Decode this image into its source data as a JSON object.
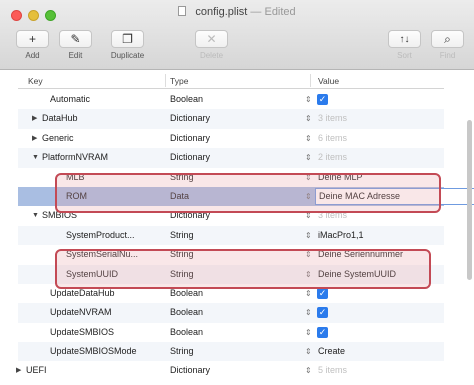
{
  "window": {
    "title": "config.plist",
    "status": "— Edited"
  },
  "toolbar": {
    "add_icon": "+",
    "add_label": "Add",
    "edit_icon": "✎",
    "edit_label": "Edit",
    "duplicate_icon": "❐",
    "duplicate_label": "Duplicate",
    "delete_icon": "✕",
    "delete_label": "Delete",
    "sort_icon": "↑↓",
    "sort_label": "Sort",
    "find_icon": "⌕",
    "find_label": "Find"
  },
  "columns": {
    "key": "Key",
    "type": "Type",
    "value": "Value"
  },
  "rows": [
    {
      "key": "Automatic",
      "type": "Boolean",
      "value": "",
      "checkbox": true
    },
    {
      "key": "DataHub",
      "type": "Dictionary",
      "value": "3 items",
      "disclosure": "▶"
    },
    {
      "key": "Generic",
      "type": "Dictionary",
      "value": "6 items",
      "disclosure": "▶"
    },
    {
      "key": "PlatformNVRAM",
      "type": "Dictionary",
      "value": "2 items",
      "disclosure": "▼"
    },
    {
      "key": "MLB",
      "type": "String",
      "value": "Deine MLP"
    },
    {
      "key": "ROM",
      "type": "Data",
      "value": "Deine MAC Adresse"
    },
    {
      "key": "SMBIOS",
      "type": "Dictionary",
      "value": "3 items",
      "disclosure": "▼"
    },
    {
      "key": "SystemProduct...",
      "type": "String",
      "value": "iMacPro1,1"
    },
    {
      "key": "SystemSerialNu...",
      "type": "String",
      "value": "Deine Seriennummer"
    },
    {
      "key": "SystemUUID",
      "type": "String",
      "value": "Deine SystemUUID"
    },
    {
      "key": "UpdateDataHub",
      "type": "Boolean",
      "value": "",
      "checkbox": true
    },
    {
      "key": "UpdateNVRAM",
      "type": "Boolean",
      "value": "",
      "checkbox": true
    },
    {
      "key": "UpdateSMBIOS",
      "type": "Boolean",
      "value": "",
      "checkbox": true
    },
    {
      "key": "UpdateSMBIOSMode",
      "type": "String",
      "value": "Create"
    },
    {
      "key": "UEFI",
      "type": "Dictionary",
      "value": "5 items",
      "disclosure": "▶"
    }
  ],
  "colors": {
    "callout": "#c34a55",
    "selection": "#a9bee2",
    "checkbox": "#2b7bec"
  }
}
